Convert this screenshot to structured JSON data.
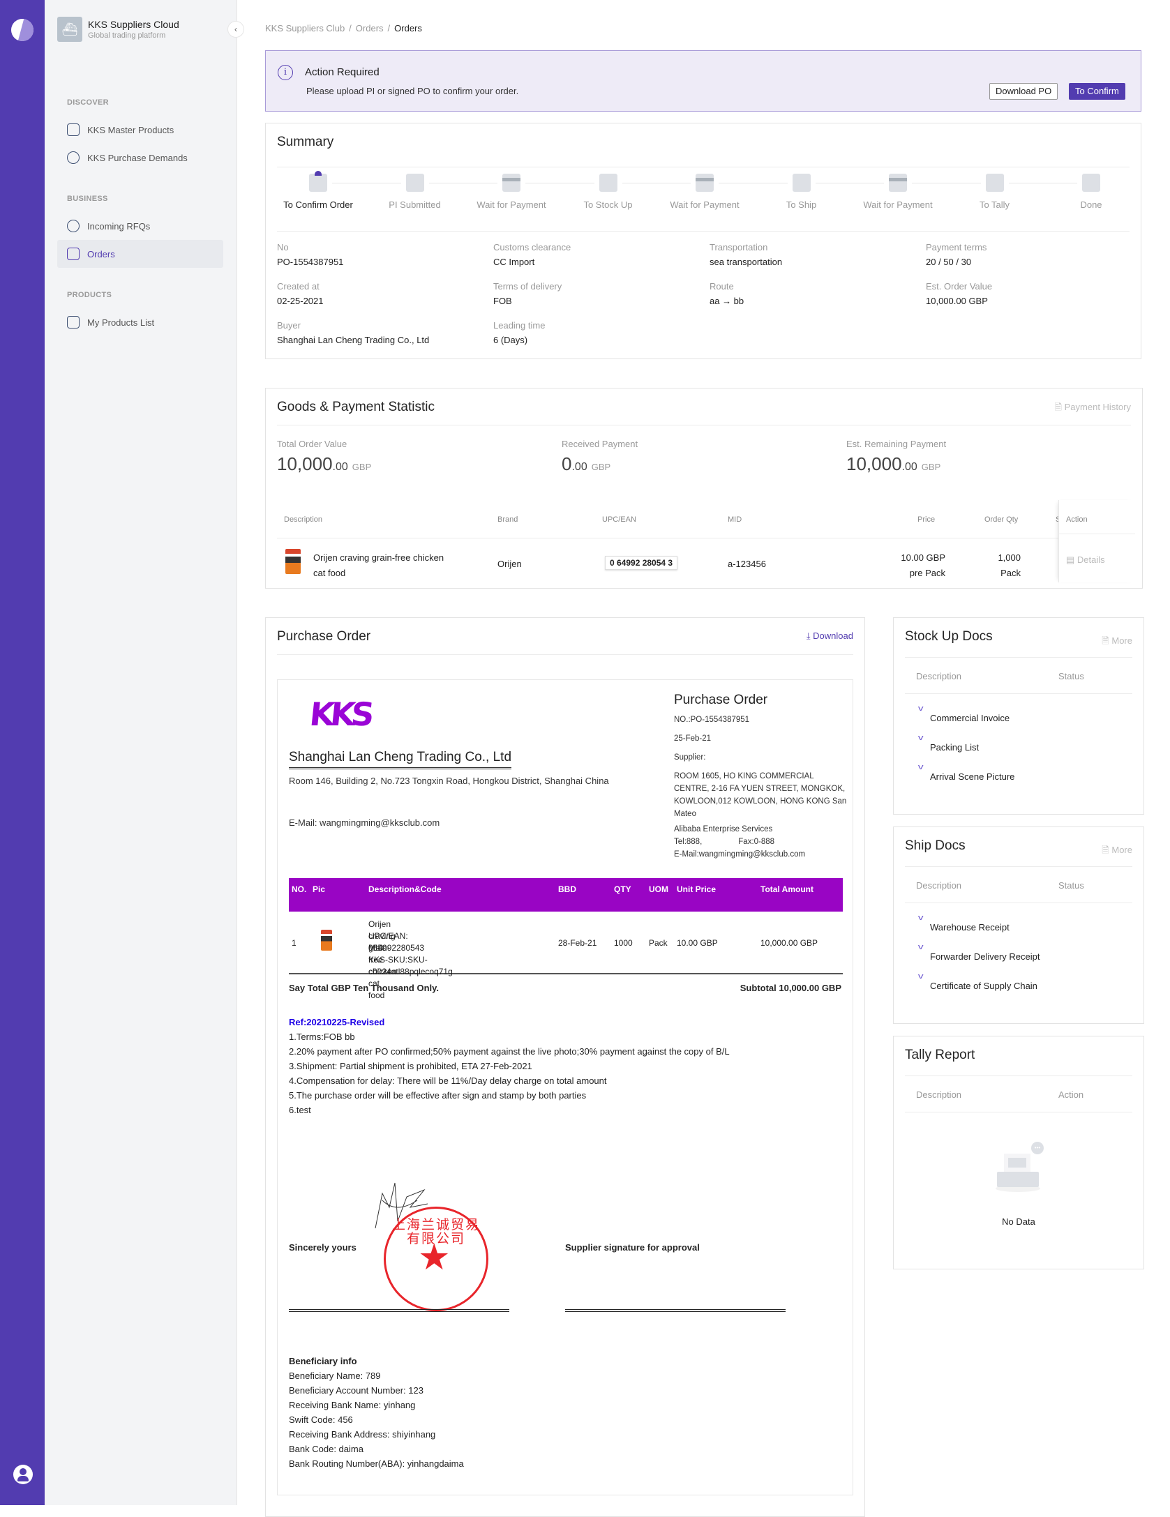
{
  "rail": {
    "logo": "kks-logo",
    "avatar": "user-icon"
  },
  "nav": {
    "app_title": "KKS Suppliers Cloud",
    "app_subtitle": "Global trading platform",
    "collapse_icon": "chevron-left-icon",
    "sections": [
      {
        "label": "DISCOVER",
        "items": [
          {
            "label": "KKS Master Products",
            "icon": "cube-icon"
          },
          {
            "label": "KKS Purchase Demands",
            "icon": "dollar-badge-icon"
          }
        ]
      },
      {
        "label": "BUSINESS",
        "items": [
          {
            "label": "Incoming RFQs",
            "icon": "target-icon"
          },
          {
            "label": "Orders",
            "icon": "clipboard-icon",
            "active": true
          }
        ]
      },
      {
        "label": "PRODUCTS",
        "items": [
          {
            "label": "My Products List",
            "icon": "box-icon"
          }
        ]
      }
    ]
  },
  "breadcrumb": [
    "KKS Suppliers Club",
    "Orders",
    "Orders"
  ],
  "alert": {
    "title": "Action Required",
    "message": "Please upload PI or signed PO to confirm your order.",
    "download_label": "Download PO",
    "confirm_label": "To Confirm"
  },
  "summary": {
    "title": "Summary",
    "steps": [
      {
        "label": "To Confirm Order",
        "active": true
      },
      {
        "label": "PI Submitted"
      },
      {
        "label": "Wait for Payment"
      },
      {
        "label": "To Stock Up"
      },
      {
        "label": "Wait for Payment"
      },
      {
        "label": "To Ship"
      },
      {
        "label": "Wait for Payment"
      },
      {
        "label": "To Tally"
      },
      {
        "label": "Done"
      }
    ],
    "fields": [
      {
        "label": "No",
        "value": "PO-1554387951"
      },
      {
        "label": "Customs clearance",
        "value": "CC Import"
      },
      {
        "label": "Transportation",
        "value": "sea transportation"
      },
      {
        "label": "Payment terms",
        "value": "20 / 50 / 30"
      },
      {
        "label": "Created at",
        "value": "02-25-2021"
      },
      {
        "label": "Terms of delivery",
        "value": "FOB"
      },
      {
        "label": "Route",
        "value": "aa → bb"
      },
      {
        "label": "Est. Order Value",
        "value": "10,000.00 GBP"
      },
      {
        "label": "Buyer",
        "value": "Shanghai Lan Cheng Trading Co., Ltd"
      },
      {
        "label": "Leading time",
        "value": "6 (Days)"
      }
    ]
  },
  "goods": {
    "title": "Goods & Payment Statistic",
    "history_label": "Payment History",
    "stats": [
      {
        "label": "Total Order Value",
        "int": "10,000",
        "dec": ".00",
        "currency": "GBP"
      },
      {
        "label": "Received Payment",
        "int": "0",
        "dec": ".00",
        "currency": "GBP"
      },
      {
        "label": "Est. Remaining Payment",
        "int": "10,000",
        "dec": ".00",
        "currency": "GBP"
      }
    ],
    "columns": [
      "Description",
      "Brand",
      "UPC/EAN",
      "MID",
      "Price",
      "Order Qty",
      "S",
      "Action"
    ],
    "rows": [
      {
        "description": "Orijen craving grain-free chicken cat food",
        "brand": "Orijen",
        "upc": "0 64992 28054 3",
        "mid": "a-123456",
        "price": "10.00 GBP",
        "price_unit": "pre Pack",
        "qty": "1,000",
        "qty_unit": "Pack",
        "action": "Details"
      }
    ]
  },
  "purchase_order": {
    "title": "Purchase Order",
    "download_label": "Download",
    "doc": {
      "logo_text": "KKS",
      "buyer_name": "Shanghai Lan Cheng Trading Co., Ltd",
      "buyer_address": "Room 146, Building 2, No.723 Tongxin Road, Hongkou District, Shanghai China",
      "buyer_email": "E-Mail: wangmingming@kksclub.com",
      "heading": "Purchase Order",
      "no": "NO.:PO-1554387951",
      "date": "25-Feb-21",
      "supplier_label": "Supplier:",
      "supplier_address": "ROOM 1605, HO KING COMMERCIAL CENTRE, 2-16 FA YUEN STREET, MONGKOK, KOWLOON,012 KOWLOON, HONG KONG San Mateo",
      "supplier_name": "Alibaba Enterprise Services",
      "tel": "Tel:888,",
      "fax": "Fax:0-888",
      "supplier_email": "E-Mail:wangmingming@kksclub.com",
      "columns": [
        "NO.",
        "Pic",
        "Description&Code",
        "BBD",
        "QTY",
        "UOM",
        "Unit Price",
        "Total Amount"
      ],
      "lines": [
        {
          "no": "1",
          "desc": "Orijen craving grain-free chicken cat food",
          "upc": "UPC/EAN: 064992280543",
          "mid": "MID:",
          "sku": "KKS-SKU:SKU-c0024atl88pqlecoq71g",
          "bbd": "28-Feb-21",
          "qty": "1000",
          "uom": "Pack",
          "unit_price": "10.00 GBP",
          "total": "10,000.00 GBP"
        }
      ],
      "say_total": "Say Total GBP Ten Thousand Only.",
      "subtotal": "Subtotal 10,000.00 GBP",
      "ref": "Ref:20210225-Revised",
      "terms": [
        "1.Terms:FOB bb",
        "2.20% payment after PO confirmed;50% payment against the live photo;30% payment against the copy of B/L",
        "3.Shipment: Partial shipment is prohibited, ETA 27-Feb-2021",
        "4.Compensation for delay: There will be 11%/Day delay charge on total amount",
        "5.The purchase order will be effective after sign and stamp by both parties",
        "6.test"
      ],
      "sign_buyer": "Sincerely yours",
      "sign_supplier": "Supplier signature for approval",
      "stamp_text": "上海兰诚贸易有限公司",
      "beneficiary_title": "Beneficiary info",
      "beneficiary": [
        "Beneficiary Name: 789",
        "Beneficiary Account Number: 123",
        "Receiving Bank Name: yinhang",
        "Swift Code: 456",
        "Receiving Bank Address: shiyinhang",
        "Bank Code: daima",
        "Bank Routing Number(ABA): yinhangdaima"
      ]
    }
  },
  "stock_docs": {
    "title": "Stock Up Docs",
    "more": "More",
    "col1": "Description",
    "col2": "Status",
    "items": [
      "Commercial Invoice",
      "Packing List",
      "Arrival Scene Picture"
    ]
  },
  "ship_docs": {
    "title": "Ship Docs",
    "more": "More",
    "col1": "Description",
    "col2": "Status",
    "items": [
      "Warehouse Receipt",
      "Forwarder Delivery Receipt",
      "Certificate of Supply Chain"
    ]
  },
  "tally": {
    "title": "Tally Report",
    "col1": "Description",
    "col2": "Action",
    "empty": "No Data"
  },
  "colors": {
    "brand": "#523cb0",
    "po_header": "#9905c4",
    "stamp": "#e8252b",
    "ref": "#1d00e6"
  }
}
